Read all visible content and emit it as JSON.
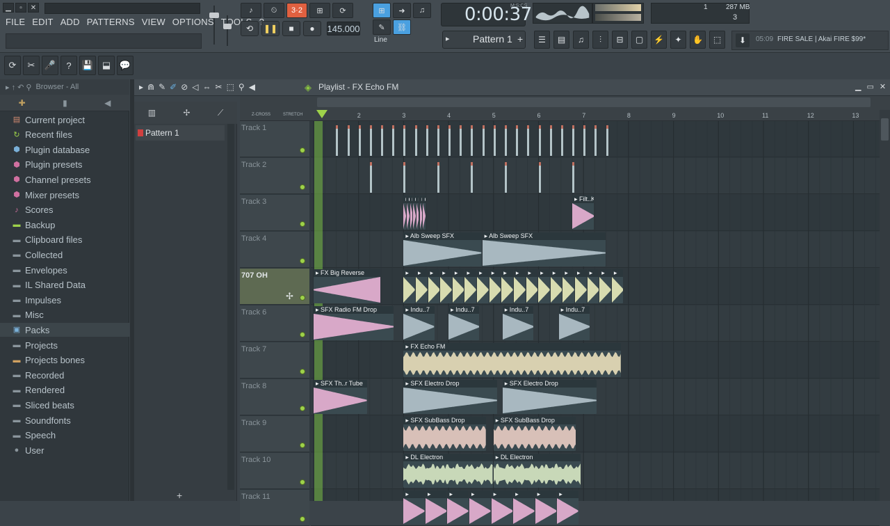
{
  "window": {
    "buttons": [
      "▁",
      "▫",
      "✕"
    ]
  },
  "menu": [
    "FILE",
    "EDIT",
    "ADD",
    "PATTERNS",
    "VIEW",
    "OPTIONS",
    "TOOLS",
    "?"
  ],
  "transport": {
    "tempo": "145.000",
    "time": "0:00:37",
    "time_unit": "M:S:CS",
    "snap": "Line",
    "pattern": "Pattern 1"
  },
  "memory": {
    "cpu_count": "1",
    "mem": "287 MB",
    "voices": "3"
  },
  "news": {
    "time": "05:09",
    "text": "FIRE SALE | Akai FIRE $99*"
  },
  "browser": {
    "header": "Browser - All",
    "items": [
      {
        "label": "Current project",
        "icon": "project-icon",
        "color": "#d08a70"
      },
      {
        "label": "Recent files",
        "icon": "recent-icon",
        "color": "#9ed24a"
      },
      {
        "label": "Plugin database",
        "icon": "plugin-icon",
        "color": "#7ab0d8"
      },
      {
        "label": "Plugin presets",
        "icon": "preset-icon",
        "color": "#d070a0"
      },
      {
        "label": "Channel presets",
        "icon": "preset-icon",
        "color": "#d070a0"
      },
      {
        "label": "Mixer presets",
        "icon": "preset-icon",
        "color": "#d070a0"
      },
      {
        "label": "Scores",
        "icon": "note-icon",
        "color": "#d070a0"
      },
      {
        "label": "Backup",
        "icon": "folder-icon",
        "color": "#9ed24a"
      },
      {
        "label": "Clipboard files",
        "icon": "folder-icon",
        "color": "#8a959c"
      },
      {
        "label": "Collected",
        "icon": "folder-icon",
        "color": "#8a959c"
      },
      {
        "label": "Envelopes",
        "icon": "folder-icon",
        "color": "#8a959c"
      },
      {
        "label": "IL Shared Data",
        "icon": "folder-icon",
        "color": "#8a959c"
      },
      {
        "label": "Impulses",
        "icon": "folder-icon",
        "color": "#8a959c"
      },
      {
        "label": "Misc",
        "icon": "folder-icon",
        "color": "#8a959c"
      },
      {
        "label": "Packs",
        "icon": "packs-icon",
        "color": "#7ab0d8"
      },
      {
        "label": "Projects",
        "icon": "folder-icon",
        "color": "#8a959c"
      },
      {
        "label": "Projects bones",
        "icon": "folder-icon",
        "color": "#d0a060"
      },
      {
        "label": "Recorded",
        "icon": "folder-icon",
        "color": "#8a959c"
      },
      {
        "label": "Rendered",
        "icon": "folder-icon",
        "color": "#8a959c"
      },
      {
        "label": "Sliced beats",
        "icon": "folder-icon",
        "color": "#8a959c"
      },
      {
        "label": "Soundfonts",
        "icon": "folder-icon",
        "color": "#8a959c"
      },
      {
        "label": "Speech",
        "icon": "folder-icon",
        "color": "#8a959c"
      },
      {
        "label": "User",
        "icon": "user-icon",
        "color": "#8a959c"
      }
    ]
  },
  "pattern_list": {
    "items": [
      "Pattern 1"
    ]
  },
  "playlist": {
    "title": "Playlist - FX Echo FM",
    "zcross": "Z-CROSS",
    "stretch": "STRETCH",
    "bars": [
      "2",
      "3",
      "4",
      "5",
      "6",
      "7",
      "8",
      "9",
      "10",
      "11",
      "12",
      "13"
    ],
    "tracks": [
      {
        "label": "Track 1"
      },
      {
        "label": "Track 2"
      },
      {
        "label": "Track 3"
      },
      {
        "label": "Track 4"
      },
      {
        "label": "707 OH",
        "selected": true
      },
      {
        "label": "Track 6"
      },
      {
        "label": "Track 7"
      },
      {
        "label": "Track 8"
      },
      {
        "label": "Track 9"
      },
      {
        "label": "Track 10"
      },
      {
        "label": "Track 11"
      }
    ],
    "clips": [
      {
        "track": 2,
        "label": "Filt..",
        "start": 3.0,
        "len": 0.5,
        "color": "#d8a8c8",
        "repeat": 7
      },
      {
        "track": 2,
        "label": "Filt..Kick",
        "start": 6.75,
        "len": 0.5,
        "color": "#d8a8c8"
      },
      {
        "track": 3,
        "label": "Alb Sweep SFX",
        "start": 3.0,
        "len": 1.75,
        "color": "#a8b8c0"
      },
      {
        "track": 3,
        "label": "Alb Sweep SFX",
        "start": 4.75,
        "len": 2.75,
        "color": "#a8b8c0"
      },
      {
        "track": 4,
        "label": "FX Big Reverse",
        "start": 1.0,
        "len": 1.5,
        "color": "#d8a8c8"
      },
      {
        "track": 4,
        "label": "",
        "start": 3.0,
        "len": 4.9,
        "color": "#d8dcb0",
        "repeat": 18
      },
      {
        "track": 5,
        "label": "SFX Radio FM Drop",
        "start": 1.0,
        "len": 1.8,
        "color": "#d8a8c8"
      },
      {
        "track": 5,
        "label": "Indu..7",
        "start": 3.0,
        "len": 0.7,
        "color": "#a8b8c0"
      },
      {
        "track": 5,
        "label": "Indu..7",
        "start": 4.0,
        "len": 0.7,
        "color": "#a8b8c0"
      },
      {
        "track": 5,
        "label": "Indu..7",
        "start": 5.2,
        "len": 0.7,
        "color": "#a8b8c0"
      },
      {
        "track": 5,
        "label": "Indu..7",
        "start": 6.45,
        "len": 0.7,
        "color": "#a8b8c0"
      },
      {
        "track": 6,
        "label": "FX Echo FM",
        "start": 3.0,
        "len": 4.85,
        "color": "#d8d0b0"
      },
      {
        "track": 7,
        "label": "SFX Th..r Tube",
        "start": 1.0,
        "len": 1.2,
        "color": "#d8a8c8"
      },
      {
        "track": 7,
        "label": "SFX Electro Drop",
        "start": 3.0,
        "len": 2.1,
        "color": "#a8b8c0"
      },
      {
        "track": 7,
        "label": "SFX Electro Drop",
        "start": 5.2,
        "len": 2.1,
        "color": "#a8b8c0"
      },
      {
        "track": 8,
        "label": "SFX SubBass Drop",
        "start": 3.0,
        "len": 1.85,
        "color": "#d8c0b8"
      },
      {
        "track": 8,
        "label": "SFX SubBass Drop",
        "start": 5.0,
        "len": 1.85,
        "color": "#d8c0b8"
      },
      {
        "track": 9,
        "label": "DL Electron",
        "start": 3.0,
        "len": 2.0,
        "color": "#c8d8b8"
      },
      {
        "track": 9,
        "label": "DL Electron",
        "start": 5.0,
        "len": 1.95,
        "color": "#c8d8b8"
      },
      {
        "track": 10,
        "label": "",
        "start": 3.0,
        "len": 3.9,
        "color": "#d8a8c8",
        "repeat": 8
      }
    ]
  }
}
